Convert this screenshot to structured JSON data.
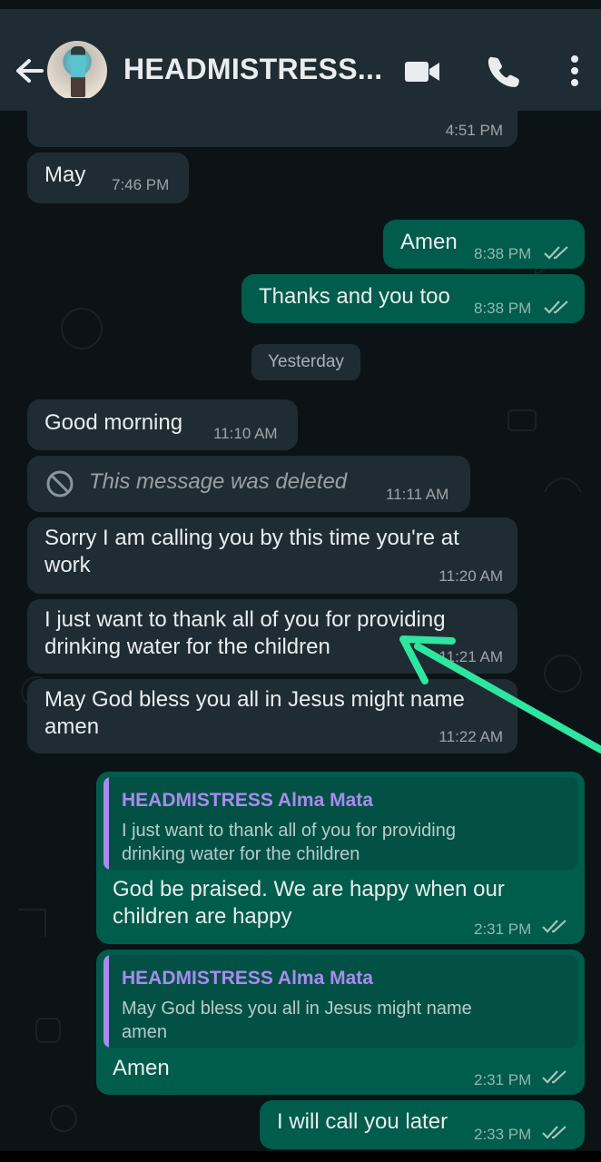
{
  "header": {
    "contact_name": "HEADMISTRESS...",
    "back_icon": "arrow-left-icon",
    "video_icon": "video-call-icon",
    "phone_icon": "phone-icon",
    "menu_icon": "more-vertical-icon"
  },
  "colors": {
    "incoming_bubble": "#202c33",
    "outgoing_bubble": "#005c4b",
    "reply_name": "#a98bf0",
    "annotation_arrow": "#2ee6a0"
  },
  "messages": [
    {
      "text": "",
      "time": "4:51 PM",
      "direction": "in"
    },
    {
      "text": "May",
      "time": "7:46 PM",
      "direction": "in"
    },
    {
      "text": "Amen",
      "time": "8:38 PM",
      "direction": "out"
    },
    {
      "text": "Thanks and you too",
      "time": "8:38 PM",
      "direction": "out"
    },
    {
      "text": "Good morning",
      "time": "11:10 AM",
      "direction": "in"
    },
    {
      "text": "This message was deleted",
      "time": "11:11 AM",
      "direction": "in",
      "deleted": true
    },
    {
      "lines": [
        "Sorry I am calling you by this time you're at",
        "work"
      ],
      "time": "11:20 AM",
      "direction": "in"
    },
    {
      "lines": [
        "I just want to thank all of you for providing",
        "drinking water for the children"
      ],
      "time": "11:21 AM",
      "direction": "in"
    },
    {
      "lines": [
        "May God bless you all in Jesus might name",
        "amen"
      ],
      "time": "11:22 AM",
      "direction": "in"
    },
    {
      "reply_to": {
        "name": "HEADMISTRESS Alma Mata",
        "lines": [
          "I just want to thank all of you for providing",
          "drinking water for the children"
        ]
      },
      "lines": [
        "God be praised. We are happy when our",
        "children are happy"
      ],
      "time": "2:31 PM",
      "direction": "out"
    },
    {
      "reply_to": {
        "name": "HEADMISTRESS Alma Mata",
        "lines": [
          "May God bless you all in Jesus might name",
          "amen"
        ]
      },
      "text": "Amen",
      "time": "2:31 PM",
      "direction": "out"
    },
    {
      "text": "I will call you later",
      "time": "2:33 PM",
      "direction": "out"
    }
  ],
  "day_separator": "Yesterday"
}
